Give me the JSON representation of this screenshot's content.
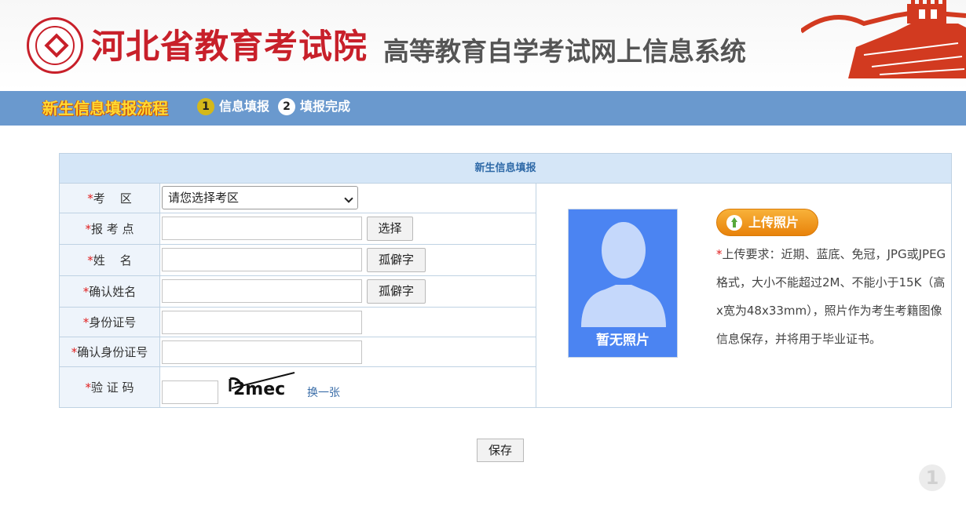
{
  "header": {
    "org_name": "河北省教育考试院",
    "system_name": "高等教育自学考试网上信息系统"
  },
  "flow": {
    "title": "新生信息填报流程",
    "steps": [
      {
        "number": "1",
        "label": "信息填报"
      },
      {
        "number": "2",
        "label": "填报完成"
      }
    ]
  },
  "form": {
    "title": "新生信息填报",
    "required_mark": "*",
    "fields": {
      "exam_area": {
        "label": "考    区",
        "selected": "请您选择考区"
      },
      "exam_point": {
        "label": "报 考 点",
        "value": "",
        "button": "选择"
      },
      "name": {
        "label": "姓    名",
        "value": "",
        "button": "孤僻字"
      },
      "confirm_name": {
        "label": "确认姓名",
        "value": "",
        "button": "孤僻字"
      },
      "id_number": {
        "label": "身份证号",
        "value": ""
      },
      "confirm_id": {
        "label": "确认身份证号",
        "value": ""
      },
      "captcha": {
        "label": "验 证 码",
        "value": "",
        "captcha_text": "2mec",
        "refresh_link": "换一张"
      }
    },
    "photo": {
      "placeholder_text": "暂无照片",
      "upload_button": "上传照片",
      "requirements": "上传要求：近期、蓝底、免冠，JPG或JPEG格式，大小不能超过2M、不能小于15K（高x宽为48x33mm），照片作为考生考籍图像信息保存，并将用于毕业证书。"
    }
  },
  "actions": {
    "save": "保存"
  },
  "floating_badge": "1",
  "colors": {
    "bar_blue": "#6a99ce",
    "title_bar": "#d5e6f7",
    "brand_red": "#c8202a",
    "upload_orange": "#e8820a",
    "photo_blue": "#4b84f2"
  }
}
